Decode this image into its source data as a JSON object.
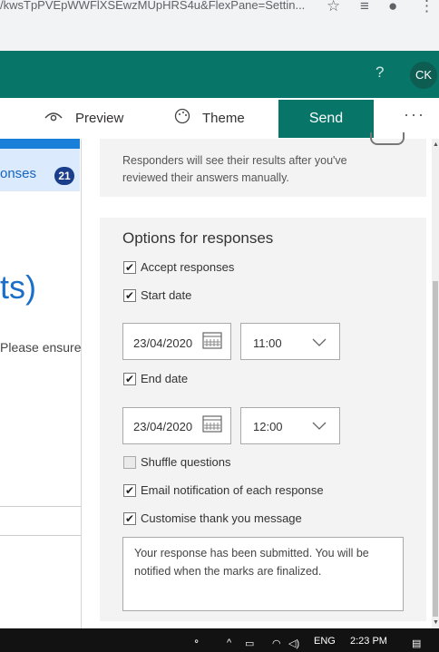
{
  "browser": {
    "url_fragment": "/kwsTpPVEpWWFlXSEwzMUpHRS4u&FlexPane=Settin..."
  },
  "header": {
    "help": "?",
    "avatar": "CK"
  },
  "toolbar": {
    "preview_label": "Preview",
    "theme_label": "Theme",
    "send_label": "Send",
    "more_label": "···"
  },
  "form_left": {
    "responses_label": "onses",
    "responses_count": "21",
    "title_fragment": "ts)",
    "description_fragment": "Please ensure"
  },
  "settings": {
    "review_note": "Responders will see their results after you've reviewed their answers manually.",
    "options_title": "Options for responses",
    "accept_responses": "Accept responses",
    "start_date_label": "Start date",
    "start_date_value": "23/04/2020",
    "start_time_value": "11:00",
    "end_date_label": "End date",
    "end_date_value": "23/04/2020",
    "end_time_value": "12:00",
    "shuffle_questions": "Shuffle questions",
    "email_notification": "Email notification of each response",
    "customise_thank_you": "Customise thank you message",
    "thank_you_message": "Your  response has been submitted. You will be notified when the marks are finalized."
  },
  "taskbar": {
    "language": "ENG",
    "time": "2:23 PM"
  }
}
